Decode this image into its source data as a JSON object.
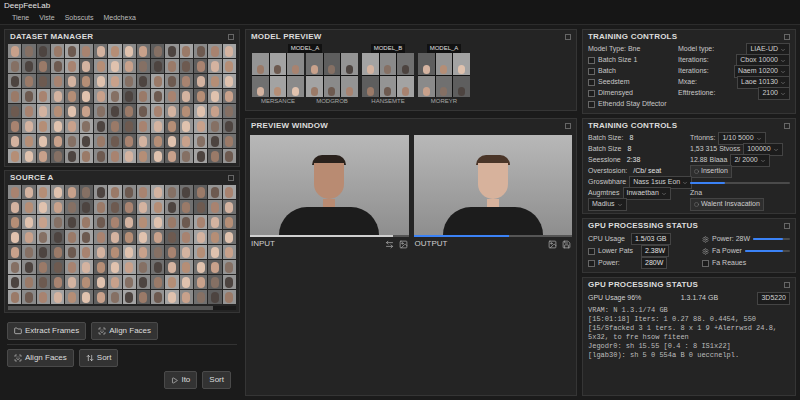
{
  "window": {
    "title": "DeepFeeLab"
  },
  "menu": [
    {
      "label": "Tiene"
    },
    {
      "label": "Viste"
    },
    {
      "label": "Sobscuts"
    },
    {
      "label": "Medchexa"
    }
  ],
  "dataset_manager": {
    "title": "DATASET MANAGER"
  },
  "source_a": {
    "title": "SOURCE A",
    "scroll_level": 0.9
  },
  "tool_buttons": [
    {
      "label": "Extract Frames"
    },
    {
      "label": "Align Faces"
    }
  ],
  "action_buttons": [
    {
      "label": "Align Faces"
    },
    {
      "label": "Sort"
    }
  ],
  "footer_buttons": [
    {
      "label": "Ito"
    },
    {
      "label": "Sort"
    }
  ],
  "model_preview": {
    "title": "MODEL PREVIEW",
    "groups": [
      {
        "label": "MODEL_A",
        "captions": [
          "MERSANCE",
          "MODGROB"
        ]
      },
      {
        "label": "MODEL_B",
        "captions": [
          "HANSEMTE"
        ]
      },
      {
        "label": "MODEL_A",
        "captions": [
          "MOREYR"
        ]
      }
    ]
  },
  "preview_window": {
    "title": "PREVIEW WINDOW",
    "panes": [
      {
        "label": "INPUT",
        "level": 0.9
      },
      {
        "label": "OUTPUT",
        "level": 0.6
      }
    ]
  },
  "training_controls": {
    "title": "TRAINING CONTROLS",
    "left": [
      {
        "kind": "text",
        "label": "Model Type: Bne"
      },
      {
        "kind": "checkbox",
        "label": "Batch Size 1",
        "checked": false
      },
      {
        "kind": "checkbox",
        "label": "Batch",
        "checked": false
      },
      {
        "kind": "checkbox",
        "label": "Seedstem",
        "checked": false
      },
      {
        "kind": "checkbox",
        "label": "Dimensyed",
        "checked": false
      },
      {
        "kind": "checkbox",
        "label": "Ethendd Stay Dtfector",
        "checked": false
      }
    ],
    "right": [
      {
        "label": "Model type:",
        "value": "LIAE-UD"
      },
      {
        "label": "Iterations:",
        "value": "Cbox 10000"
      },
      {
        "label": "Iterations:",
        "value": "Naem 10200"
      },
      {
        "label": "Mxae:",
        "value": "Laoe 10130"
      },
      {
        "label": "Efttrestione:",
        "value": "2100"
      }
    ]
  },
  "training_controls_2": {
    "title": "TRAINING CONTROLS",
    "rows": [
      {
        "left": {
          "kind": "text",
          "label": "Batch Size:",
          "value": "8"
        },
        "right": {
          "kind": "dropdown",
          "label": "Trtonns:",
          "value": "1/10 5000"
        }
      },
      {
        "left": {
          "kind": "text",
          "label": "Batch Size",
          "value": "8"
        },
        "right": {
          "kind": "dropdown",
          "label": "1,53 315 Stvoss",
          "value": "100000"
        }
      },
      {
        "left": {
          "kind": "text",
          "label": "Seesslone",
          "value": "2:38"
        },
        "right": {
          "kind": "dropdown",
          "label": "12.88 Blaaa",
          "value": "2/ 2000"
        }
      },
      {
        "left": {
          "kind": "text",
          "label": "Overstosion:",
          "value": "/Cb/ seat"
        },
        "right": {
          "kind": "button",
          "label": "Insertion"
        }
      },
      {
        "left": {
          "kind": "dropdown",
          "label": "Groswbhare",
          "value": "Nass 1sus Eon"
        },
        "right": {
          "kind": "slider",
          "level": 0.35
        }
      },
      {
        "left": {
          "kind": "dropdown",
          "label": "Augmtnes",
          "value": "Inwaetban"
        },
        "right": {
          "kind": "text",
          "label": "Zna",
          "value": ""
        }
      },
      {
        "left": {
          "kind": "dropdown",
          "label": "",
          "value": "Madius"
        },
        "right": {
          "kind": "button",
          "label": "Walent Insvacation"
        }
      }
    ]
  },
  "gpu_status": {
    "title": "GPU PROCESSING STATUS",
    "left": [
      {
        "kind": "text",
        "label": "CPU Usage",
        "value": "1.5/03 GB"
      },
      {
        "kind": "checkbox",
        "label": "Lower Pats",
        "value": "2.38W",
        "checked": false
      },
      {
        "kind": "checkbox",
        "label": "Power:",
        "value": "280W",
        "checked": false
      }
    ],
    "right": [
      {
        "kind": "slider",
        "label": "Power: 28W",
        "level": 0.8
      },
      {
        "kind": "slider",
        "label": "Fa Power",
        "level": 0.85
      },
      {
        "kind": "checkbox",
        "label": "Fa Reaues",
        "checked": false
      }
    ]
  },
  "gpu_log": {
    "title": "GPU PROCESSING STATUS",
    "summary": [
      "GPU Usage 96%",
      "1.3.1.74 GB",
      "3D5220"
    ],
    "lines": [
      "VRAM: N 1.3.1/74 GB",
      "[15:01:18] Iters: 1 0.27 88. 0.4454, 550",
      "[15/Sfacked 3 1 ters. 8 x 1 9 +Alerrwsd 24.8, 5x32, to fre hsow fiteen",
      "Jegodr0: sh 15.55 [0.4 : 8 IS1x22]",
      "[lgab30): sh 5 0 554a B 0 ueccnelpl."
    ]
  }
}
